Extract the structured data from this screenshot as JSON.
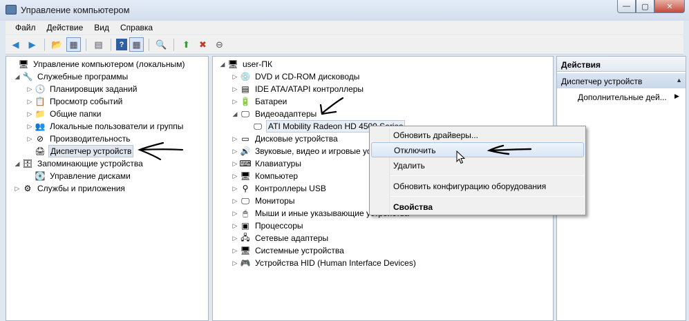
{
  "window": {
    "title": "Управление компьютером",
    "min": "—",
    "max": "▢",
    "close": "✕"
  },
  "menu": [
    "Файл",
    "Действие",
    "Вид",
    "Справка"
  ],
  "left_tree": [
    {
      "label": "Управление компьютером (локальным)",
      "icon": "computer-management-icon",
      "glyph": "🖥",
      "toggle": ""
    },
    {
      "label": "Служебные программы",
      "icon": "tools-icon",
      "glyph": "🔧",
      "toggle": "◢"
    },
    {
      "label": "Планировщик заданий",
      "icon": "clock-icon",
      "glyph": "🕓",
      "toggle": "▷"
    },
    {
      "label": "Просмотр событий",
      "icon": "event-viewer-icon",
      "glyph": "📋",
      "toggle": "▷"
    },
    {
      "label": "Общие папки",
      "icon": "shared-folder-icon",
      "glyph": "📁",
      "toggle": "▷"
    },
    {
      "label": "Локальные пользователи и группы",
      "icon": "users-icon",
      "glyph": "👥",
      "toggle": "▷"
    },
    {
      "label": "Производительность",
      "icon": "performance-icon",
      "glyph": "⊘",
      "toggle": "▷"
    },
    {
      "label": "Диспетчер устройств",
      "icon": "device-manager-icon",
      "glyph": "🖨",
      "toggle": ""
    },
    {
      "label": "Запоминающие устройства",
      "icon": "storage-icon",
      "glyph": "🗄",
      "toggle": "◢"
    },
    {
      "label": "Управление дисками",
      "icon": "disk-management-icon",
      "glyph": "💽",
      "toggle": ""
    },
    {
      "label": "Службы и приложения",
      "icon": "services-icon",
      "glyph": "⚙",
      "toggle": "▷"
    }
  ],
  "device_tree": [
    {
      "label": "user-ПК",
      "icon": "computer-icon",
      "glyph": "🖥",
      "toggle": "◢"
    },
    {
      "label": "DVD и CD-ROM дисководы",
      "icon": "dvd-drive-icon",
      "glyph": "💿",
      "toggle": "▷"
    },
    {
      "label": "IDE ATA/ATAPI контроллеры",
      "icon": "ide-controller-icon",
      "glyph": "▤",
      "toggle": "▷"
    },
    {
      "label": "Батареи",
      "icon": "battery-icon",
      "glyph": "🔋",
      "toggle": "▷"
    },
    {
      "label": "Видеоадаптеры",
      "icon": "display-adapter-icon",
      "glyph": "🖵",
      "toggle": "◢"
    },
    {
      "label": "ATI Mobility Radeon HD 4500 Series",
      "icon": "monitor-icon",
      "glyph": "🖵",
      "toggle": ""
    },
    {
      "label": "Дисковые устройства",
      "icon": "disk-drive-icon",
      "glyph": "▭",
      "toggle": "▷"
    },
    {
      "label": "Звуковые, видео и игровые устройства",
      "icon": "speaker-icon",
      "glyph": "🔊",
      "toggle": "▷"
    },
    {
      "label": "Клавиатуры",
      "icon": "keyboard-icon",
      "glyph": "⌨",
      "toggle": "▷"
    },
    {
      "label": "Компьютер",
      "icon": "computer-icon",
      "glyph": "🖥",
      "toggle": "▷"
    },
    {
      "label": "Контроллеры USB",
      "icon": "usb-icon",
      "glyph": "⚲",
      "toggle": "▷"
    },
    {
      "label": "Мониторы",
      "icon": "monitor-icon",
      "glyph": "🖵",
      "toggle": "▷"
    },
    {
      "label": "Мыши и иные указывающие устройства",
      "icon": "mouse-icon",
      "glyph": "🖱",
      "toggle": "▷"
    },
    {
      "label": "Процессоры",
      "icon": "cpu-icon",
      "glyph": "▣",
      "toggle": "▷"
    },
    {
      "label": "Сетевые адаптеры",
      "icon": "network-adapter-icon",
      "glyph": "🖧",
      "toggle": "▷"
    },
    {
      "label": "Системные устройства",
      "icon": "system-device-icon",
      "glyph": "🖥",
      "toggle": "▷"
    },
    {
      "label": "Устройства HID (Human Interface Devices)",
      "icon": "hid-icon",
      "glyph": "🎮",
      "toggle": "▷"
    }
  ],
  "actions": {
    "header": "Действия",
    "section": "Диспетчер устройств",
    "more": "Дополнительные дей...",
    "collapse_glyph": "▲",
    "more_glyph": "▶"
  },
  "context_menu": [
    "Обновить драйверы...",
    "Отключить",
    "Удалить",
    "Обновить конфигурацию оборудования",
    "Свойства"
  ],
  "colors": {
    "accent": "#3a6ea5",
    "selection": "#dfe6ee",
    "hover": "#dae6f4"
  }
}
